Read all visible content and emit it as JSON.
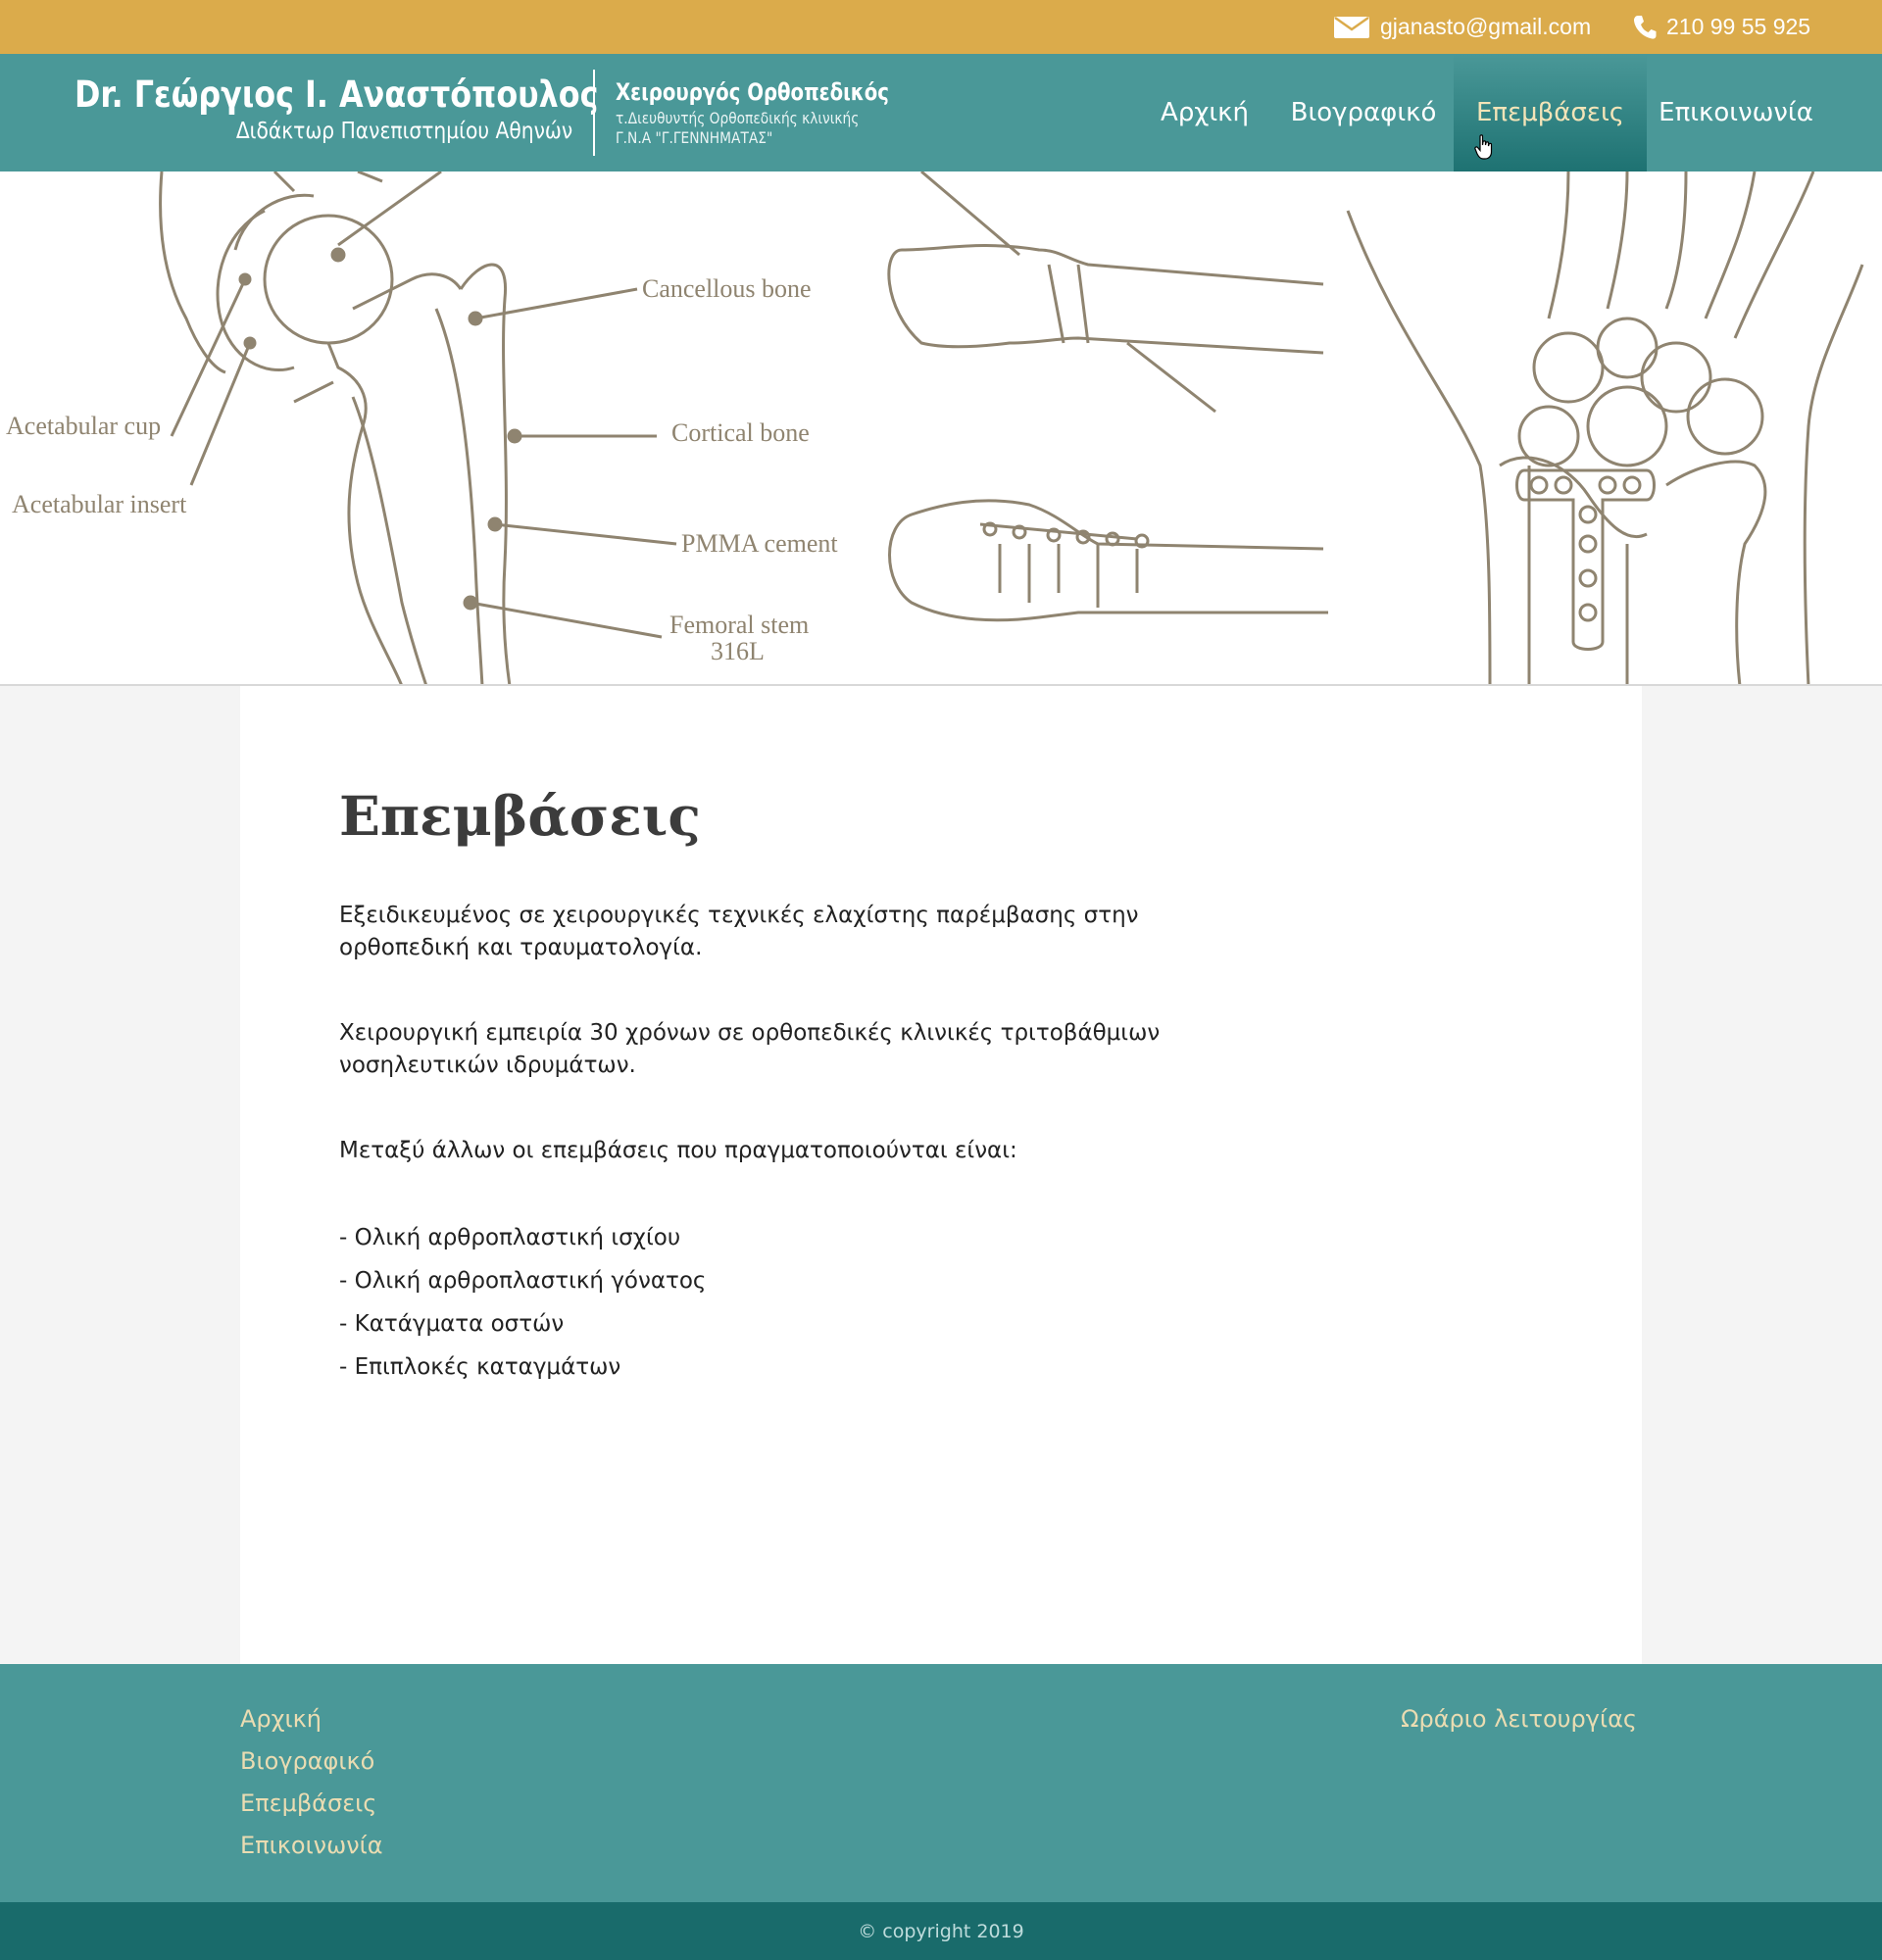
{
  "topbar": {
    "email": "gjanasto@gmail.com",
    "phone": "210 99 55 925",
    "email_icon": "envelope-icon",
    "phone_icon": "phone-icon",
    "color": "#dbab4b"
  },
  "header": {
    "doctor_name": "Dr. Γεώργιος Ι. Αναστόπουλος",
    "doctor_title": "Διδάκτωρ Πανεπιστημίου Αθηνών",
    "specialty": "Χειρουργός Ορθοπεδικός",
    "position_line1": "τ.Διευθυντής Ορθοπεδικής κλινικής",
    "position_line2": "Γ.Ν.Α \"Γ.ΓΕΝΝΗΜΑΤΑΣ\"",
    "color": "#4a9898"
  },
  "nav": {
    "items": [
      {
        "label": "Αρχική"
      },
      {
        "label": "Βιογραφικό"
      },
      {
        "label": "Επεμβάσεις",
        "active": true
      },
      {
        "label": "Επικοινωνία"
      }
    ]
  },
  "hero": {
    "labels": {
      "acetabular_cup": "Acetabular cup",
      "acetabular_insert": "Acetabular insert",
      "cancellous_bone": "Cancellous bone",
      "cortical_bone": "Cortical bone",
      "pmma_cement": "PMMA cement",
      "femoral_stem": "Femoral stem",
      "femoral_stem_grade": "316L"
    }
  },
  "content": {
    "title": "Επεμβάσεις",
    "paragraph1": "Εξειδικευμένος σε χειρουργικές τεχνικές ελαχίστης παρέμβασης στην ορθοπεδική και τραυματολογία.",
    "paragraph2": "Χειρουργική εμπειρία 30 χρόνων σε ορθοπεδικές κλινικές τριτοβάθμιων νοσηλευτικών ιδρυμάτων.",
    "paragraph3": "Μεταξύ άλλων οι επεμβάσεις που πραγματοποιούνται είναι:",
    "operations": [
      "- Ολική αρθροπλαστική ισχίου",
      "- Ολική αρθροπλαστική γόνατος",
      "- Κατάγματα οστών",
      "- Επιπλοκές καταγμάτων"
    ]
  },
  "footer": {
    "links": [
      "Αρχική",
      "Βιογραφικό",
      "Επεμβάσεις",
      "Επικοινωνία"
    ],
    "hours_link": "Ωράριο λειτουργίας",
    "copyright": "© copyright 2019",
    "link_color": "#eadcb2"
  }
}
